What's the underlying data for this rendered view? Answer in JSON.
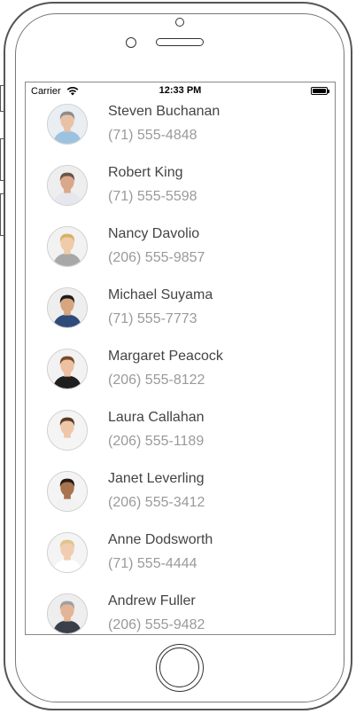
{
  "status_bar": {
    "carrier": "Carrier",
    "time": "12:33 PM"
  },
  "contacts": [
    {
      "name": "Steven Buchanan",
      "phone": "(71) 555-4848",
      "bg": "#e9eef3",
      "skin": "#e9c2a6",
      "hair": "#8c8c8c",
      "shirt": "#9cc2e0"
    },
    {
      "name": "Robert King",
      "phone": "(71) 555-5598",
      "bg": "#eeeeee",
      "skin": "#d9a78a",
      "hair": "#6b5545",
      "shirt": "#e6e6ee"
    },
    {
      "name": "Nancy Davolio",
      "phone": "(206) 555-9857",
      "bg": "#f2f2f2",
      "skin": "#f0cba9",
      "hair": "#d8b06a",
      "shirt": "#a8a8a8"
    },
    {
      "name": "Michael Suyama",
      "phone": "(71) 555-7773",
      "bg": "#eeeeee",
      "skin": "#d7a57e",
      "hair": "#1e1e1e",
      "shirt": "#2e4b7a"
    },
    {
      "name": "Margaret Peacock",
      "phone": "(206) 555-8122",
      "bg": "#f2f2f2",
      "skin": "#ecc0a0",
      "hair": "#7a4a2a",
      "shirt": "#1f1f1f"
    },
    {
      "name": "Laura Callahan",
      "phone": "(206) 555-1189",
      "bg": "#f4f4f4",
      "skin": "#eec6a8",
      "hair": "#5a3a22",
      "shirt": "#f5f5f5"
    },
    {
      "name": "Janet Leverling",
      "phone": "(206) 555-3412",
      "bg": "#f4f4f4",
      "skin": "#a8734f",
      "hair": "#2a1a10",
      "shirt": "#f2f2f2"
    },
    {
      "name": "Anne Dodsworth",
      "phone": "(71) 555-4444",
      "bg": "#f4f4f4",
      "skin": "#f0cdb0",
      "hair": "#e0c48a",
      "shirt": "#ffffff"
    },
    {
      "name": "Andrew Fuller",
      "phone": "(206) 555-9482",
      "bg": "#eeeeee",
      "skin": "#e3b596",
      "hair": "#a0a0a0",
      "shirt": "#3a3f4a"
    }
  ]
}
